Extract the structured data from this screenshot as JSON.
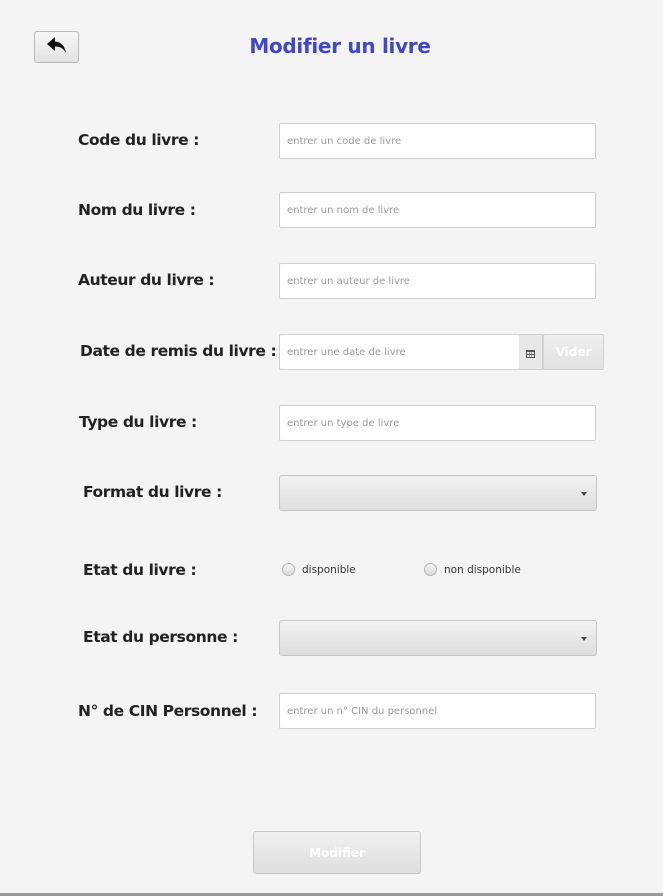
{
  "header": {
    "back_icon": "undo-arrow-icon",
    "title": "Modifier un livre",
    "title_color": "#3f48cc"
  },
  "form": {
    "code": {
      "label": "Code du livre :",
      "placeholder": "entrer un code de livre",
      "value": ""
    },
    "nom": {
      "label": "Nom du livre :",
      "placeholder": "entrer un nom de livre",
      "value": ""
    },
    "auteur": {
      "label": "Auteur du livre :",
      "placeholder": "entrer un auteur de livre",
      "value": ""
    },
    "date": {
      "label": "Date de remis du livre :",
      "placeholder": "entrer une date de livre",
      "value": "",
      "calendar_icon": "calendar-icon",
      "clear_label": "Vider"
    },
    "type": {
      "label": "Type du livre :",
      "placeholder": "entrer un type de livre",
      "value": ""
    },
    "format": {
      "label": "Format du livre :",
      "selected": ""
    },
    "etat": {
      "label": "Etat du livre :",
      "options": [
        "disponible",
        "non disponible"
      ]
    },
    "etat_personne": {
      "label": "Etat du personne :",
      "selected": ""
    },
    "cin": {
      "label": "N° de CIN Personnel :",
      "placeholder": "entrer un n° CIN du personnel",
      "value": ""
    }
  },
  "actions": {
    "submit_label": "Modifier"
  }
}
